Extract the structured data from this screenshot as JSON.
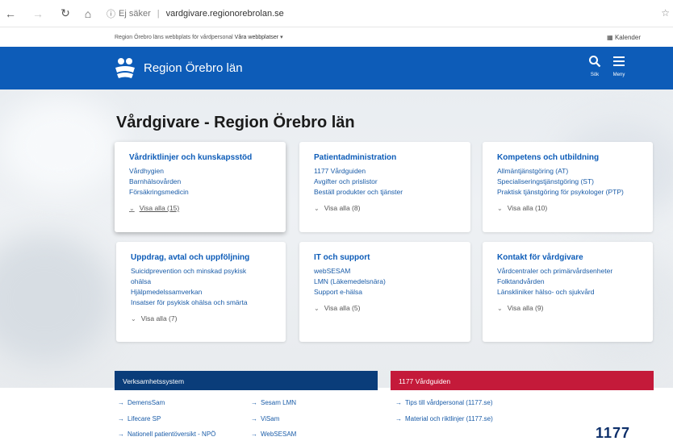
{
  "browser": {
    "not_secure": "Ej säker",
    "url": "vardgivare.regionorebrolan.se"
  },
  "util_bar": {
    "prefix": "Region Örebro läns webbplats för vårdpersonal",
    "sites": "Våra webbplatser",
    "calendar": "Kalender"
  },
  "header": {
    "brand": "Region Örebro län",
    "search_label": "Sök",
    "menu_label": "Meny"
  },
  "page_title": "Vårdgivare - Region Örebro län",
  "cards": [
    {
      "title": "Vårdriktlinjer och kunskapsstöd",
      "links": [
        "Vårdhygien",
        "Barnhälsovården",
        "Försäkringsmedicin"
      ],
      "show_all": "Visa alla (15)"
    },
    {
      "title": "Patientadministration",
      "links": [
        "1177 Vårdguiden",
        "Avgifter och prislistor",
        "Beställ produkter och tjänster"
      ],
      "show_all": "Visa alla (8)"
    },
    {
      "title": "Kompetens och utbildning",
      "links": [
        "Allmäntjänstgöring (AT)",
        "Specialiseringstjänstgöring (ST)",
        "Praktisk tjänstgöring för psykologer (PTP)"
      ],
      "show_all": "Visa alla (10)"
    },
    {
      "title": "Uppdrag, avtal och uppföljning",
      "links": [
        "Suicidprevention och minskad psykisk",
        "ohälsa",
        "Hjälpmedelssamverkan",
        "Insatser för psykisk ohälsa och smärta"
      ],
      "show_all": "Visa alla (7)"
    },
    {
      "title": "IT och support",
      "links": [
        "webSESAM",
        "LMN (Läkemedelsnära)",
        "Support e-hälsa"
      ],
      "show_all": "Visa alla (5)"
    },
    {
      "title": "Kontakt för vårdgivare",
      "links": [
        "Vårdcentraler och primärvårdsenheter",
        "Folktandvården",
        "Länskliniker hälso- och sjukvård"
      ],
      "show_all": "Visa alla (9)"
    }
  ],
  "systems": {
    "title": "Verksamhetssystem",
    "links": [
      "DemensSam",
      "Sesam LMN",
      "Lifecare SP",
      "ViSam",
      "Nationell patientöversikt - NPÖ",
      "WebSESAM"
    ]
  },
  "vardguiden": {
    "title": "1177 Vårdguiden",
    "links": [
      "Tips till vårdpersonal (1177.se)",
      "Material och riktlinjer (1177.se)"
    ],
    "logo_text": "1177"
  },
  "colors": {
    "brand_blue": "#0d5cb8",
    "dark_blue": "#0a3d7a",
    "red": "#c41a3a"
  }
}
